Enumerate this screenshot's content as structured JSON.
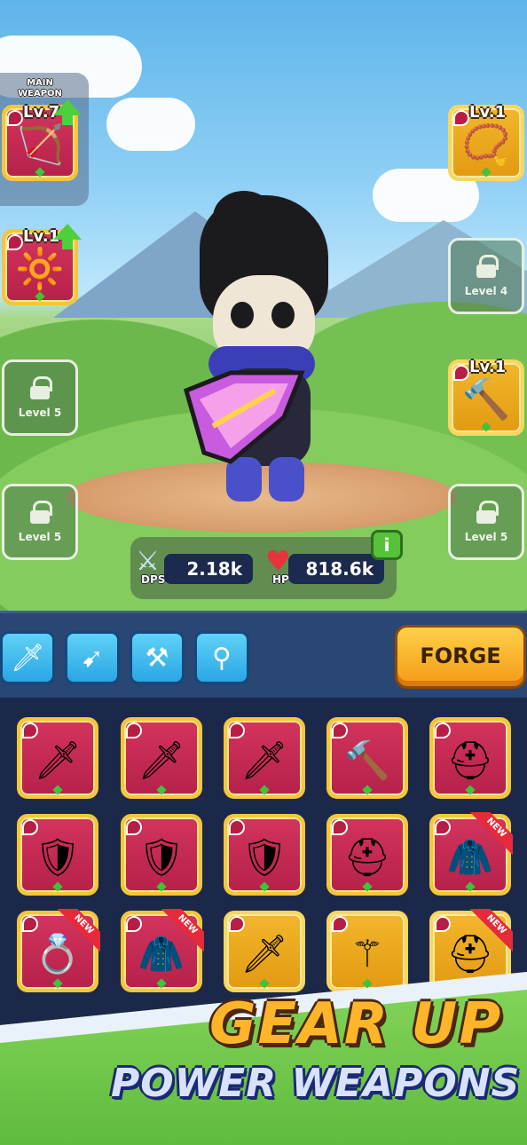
{
  "hero_panel": {
    "main_weapon_label": "MAIN\nWEAPON",
    "left_slots": [
      {
        "level": "Lv.7",
        "icon": "bow",
        "glyph": "🏹",
        "style": "red",
        "upgrade": true
      },
      {
        "level": "Lv.1",
        "icon": "sun-staff",
        "glyph": "🔆",
        "style": "red",
        "upgrade": true
      },
      {
        "locked_label": "Level 5"
      },
      {
        "locked_label": "Level 5"
      }
    ],
    "right_slots": [
      {
        "level": "Lv.1",
        "icon": "amulet",
        "glyph": "📿",
        "style": "gold",
        "upgrade": false
      },
      {
        "locked_label": "Level 4"
      },
      {
        "level": "Lv.1",
        "icon": "hammer",
        "glyph": "🔨",
        "style": "gold",
        "upgrade": false
      },
      {
        "locked_label": "Level 5"
      }
    ]
  },
  "stats": {
    "dps_label": "DPS",
    "dps_value": "2.18k",
    "hp_label": "HP",
    "hp_value": "818.6k",
    "info_label": "i"
  },
  "toolbar": {
    "filters": [
      {
        "name": "sword",
        "glyph": "🗡"
      },
      {
        "name": "bow",
        "glyph": "➹"
      },
      {
        "name": "hammer",
        "glyph": "⚒"
      },
      {
        "name": "staff",
        "glyph": "⚲"
      }
    ],
    "forge_label": "FORGE"
  },
  "inventory": [
    {
      "icon": "sword",
      "glyph": "🗡",
      "style": "red",
      "new": false
    },
    {
      "icon": "sword",
      "glyph": "🗡",
      "style": "red",
      "new": false
    },
    {
      "icon": "sword",
      "glyph": "🗡",
      "style": "red",
      "new": false
    },
    {
      "icon": "hammer",
      "glyph": "🔨",
      "style": "red",
      "new": false
    },
    {
      "icon": "helmet",
      "glyph": "⛑",
      "style": "red",
      "new": false
    },
    {
      "icon": "armor",
      "glyph": "🛡",
      "style": "red",
      "new": false
    },
    {
      "icon": "armor",
      "glyph": "🛡",
      "style": "red",
      "new": false
    },
    {
      "icon": "armor",
      "glyph": "🛡",
      "style": "red",
      "new": false
    },
    {
      "icon": "helmet",
      "glyph": "⛑",
      "style": "red",
      "new": false
    },
    {
      "icon": "cape",
      "glyph": "🧥",
      "style": "red",
      "new": true
    },
    {
      "icon": "ring",
      "glyph": "💍",
      "style": "red",
      "new": true
    },
    {
      "icon": "cape",
      "glyph": "🧥",
      "style": "red",
      "new": true
    },
    {
      "icon": "sword",
      "glyph": "🗡",
      "style": "gold",
      "new": false
    },
    {
      "icon": "staff",
      "glyph": "⚚",
      "style": "gold",
      "new": false
    },
    {
      "icon": "helmet",
      "glyph": "⛑",
      "style": "gold",
      "new": true
    }
  ],
  "new_tag_label": "NEW",
  "banner": {
    "line1": "GEAR UP",
    "line2": "POWER WEAPONS"
  },
  "colors": {
    "slot_red": "#c72a52",
    "slot_gold": "#eea820",
    "forge": "#f7b52c",
    "filter_button": "#3dbcef",
    "panel_bg": "#1b2849"
  }
}
